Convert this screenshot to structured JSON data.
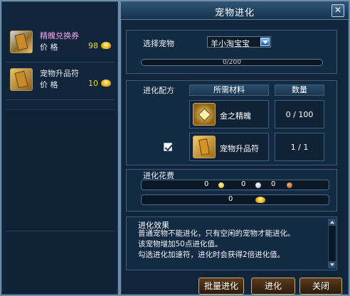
{
  "left": {
    "items": [
      {
        "name": "精魄兑换券",
        "price_label": "价  格",
        "price": "98"
      },
      {
        "name": "宠物升品符",
        "price_label": "价  格",
        "price": "10"
      }
    ]
  },
  "window": {
    "title": "宠物进化",
    "close_symbol": "✕"
  },
  "select": {
    "label": "选择宠物",
    "pet_value": "羊小淘宝宝",
    "progress_text": "0/200",
    "progress_ratio": 0
  },
  "recipe": {
    "label": "进化配方",
    "col_material": "所需材料",
    "col_qty": "数量",
    "materials": [
      {
        "name": "金之精魄",
        "qty": "0 / 100"
      },
      {
        "name": "宠物升品符",
        "qty": "1 / 1"
      }
    ]
  },
  "cost": {
    "label": "进化花费",
    "gold": "0",
    "silver": "0",
    "copper": "0",
    "ingot": "0"
  },
  "effect": {
    "title": "进化效果",
    "lines": [
      "普通宠物不能进化，只有空闲的宠物才能进化。",
      "该宠物增加50点进化值。",
      "勾选进化加速符，进化时会获得2倍进化值。"
    ]
  },
  "buttons": {
    "batch": "批量进化",
    "evolve": "进化",
    "close": "关闭"
  }
}
